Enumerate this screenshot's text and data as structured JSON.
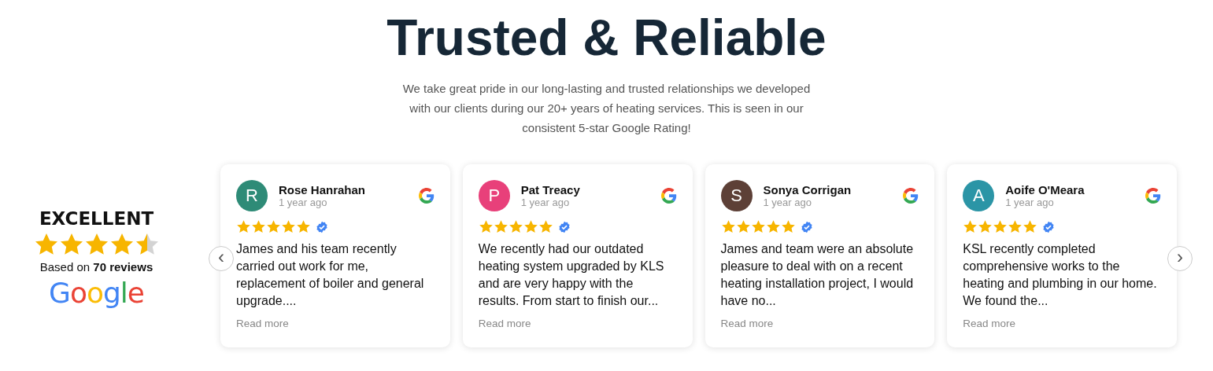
{
  "heading": "Trusted & Reliable",
  "intro": "We take great pride in our long-lasting and trusted relationships we developed with our clients during our 20+ years of heating services. This is seen in our consistent 5-star Google Rating!",
  "summary": {
    "rating_label": "EXCELLENT",
    "stars": 4.5,
    "based_on": "Based on **70 reviews**",
    "logo_text": "Google"
  },
  "carousel": {
    "prev": "‹",
    "next": "›"
  },
  "reviews": [
    {
      "initial": "R",
      "color": "#2e8b77",
      "name": "Rose Hanrahan",
      "time": "1 year ago",
      "stars": 5,
      "text": "James and his team recently carried out work for me, replacement of boiler and general upgrade....",
      "read_more": "Read more"
    },
    {
      "initial": "P",
      "color": "#e8407a",
      "name": "Pat Treacy",
      "time": "1 year ago",
      "stars": 5,
      "text": "We recently had our outdated heating system upgraded by KLS and are very happy with the results. From start to finish our...",
      "read_more": "Read more"
    },
    {
      "initial": "S",
      "color": "#5d4037",
      "name": "Sonya Corrigan",
      "time": "1 year ago",
      "stars": 5,
      "text": "James and team were an absolute pleasure to deal with on a recent heating installation project, I would have no...",
      "read_more": "Read more"
    },
    {
      "initial": "A",
      "color": "#2b95a6",
      "name": "Aoife O'Meara",
      "time": "1 year ago",
      "stars": 5,
      "text": "KSL recently completed comprehensive works to the heating and plumbing in our home. We found the...",
      "read_more": "Read more"
    }
  ]
}
